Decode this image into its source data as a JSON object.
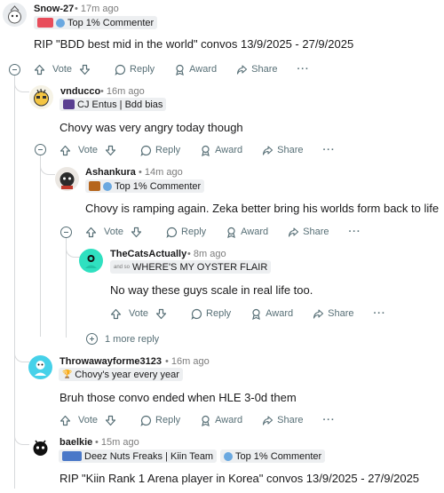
{
  "actions": {
    "vote": "Vote",
    "reply": "Reply",
    "award": "Award",
    "share": "Share",
    "more": "···"
  },
  "comments": [
    {
      "username": "Snow-27",
      "time": "• 17m ago",
      "flairs": [
        "Top 1% Commenter"
      ],
      "body": "RIP \"BDD best mid in the world\" convos 13/9/2025 - 27/9/2025"
    },
    {
      "username": "vnducco",
      "time": "• 16m ago",
      "flairs": [
        "CJ Entus | Bdd bias"
      ],
      "body": "Chovy was very angry today though"
    },
    {
      "username": "Ashankura",
      "time": "• 14m ago",
      "flairs": [
        "Top 1% Commenter"
      ],
      "body": "Chovy is ramping again. Zeka better bring his worlds form back to life"
    },
    {
      "username": "TheCatsActually",
      "time": "• 8m ago",
      "flairs": [
        "WHERE'S MY OYSTER FLAIR"
      ],
      "body": "No way these guys scale in real life too."
    },
    {
      "username": "Throwawayforme3123",
      "time": "• 16m ago",
      "flairs": [
        "Chovy's year every year"
      ],
      "body": "Bruh those convo ended when HLE 3-0d them"
    },
    {
      "username": "baelkie",
      "time": "• 15m ago",
      "flairs": [
        "Deez Nuts Freaks | Kiin Team",
        "Top 1% Commenter"
      ],
      "body": "RIP \"Kiin Rank 1 Arena player in Korea\" convos 13/9/2025 - 27/9/2025"
    }
  ],
  "more_replies": "1 more reply"
}
